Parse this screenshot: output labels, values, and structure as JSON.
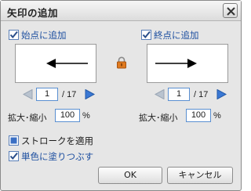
{
  "dialog": {
    "title": "矢印の追加",
    "close_icon": "close-x-icon"
  },
  "start": {
    "checkbox_label": "始点に追加",
    "checked": true,
    "arrow_direction": "left",
    "page_current": "1",
    "page_total": "/ 17",
    "scale_label": "拡大･縮小",
    "scale_value": "100",
    "scale_unit": "%"
  },
  "end": {
    "checkbox_label": "終点に追加",
    "checked": true,
    "arrow_direction": "right",
    "page_current": "1",
    "page_total": "/ 17",
    "scale_label": "拡大･縮小",
    "scale_value": "100",
    "scale_unit": "%"
  },
  "link_icon": "lock-icon",
  "options": {
    "apply_stroke_label": "ストロークを適用",
    "apply_stroke_checked": false,
    "fill_single_color_label": "単色に塗りつぶす",
    "fill_single_color_checked": true
  },
  "buttons": {
    "ok_label": "OK",
    "cancel_label": "キャンセル"
  },
  "colors": {
    "accent": "#3a6fc4",
    "checkbox_label": "#1d4fa0",
    "lock": "#e07a1f"
  }
}
